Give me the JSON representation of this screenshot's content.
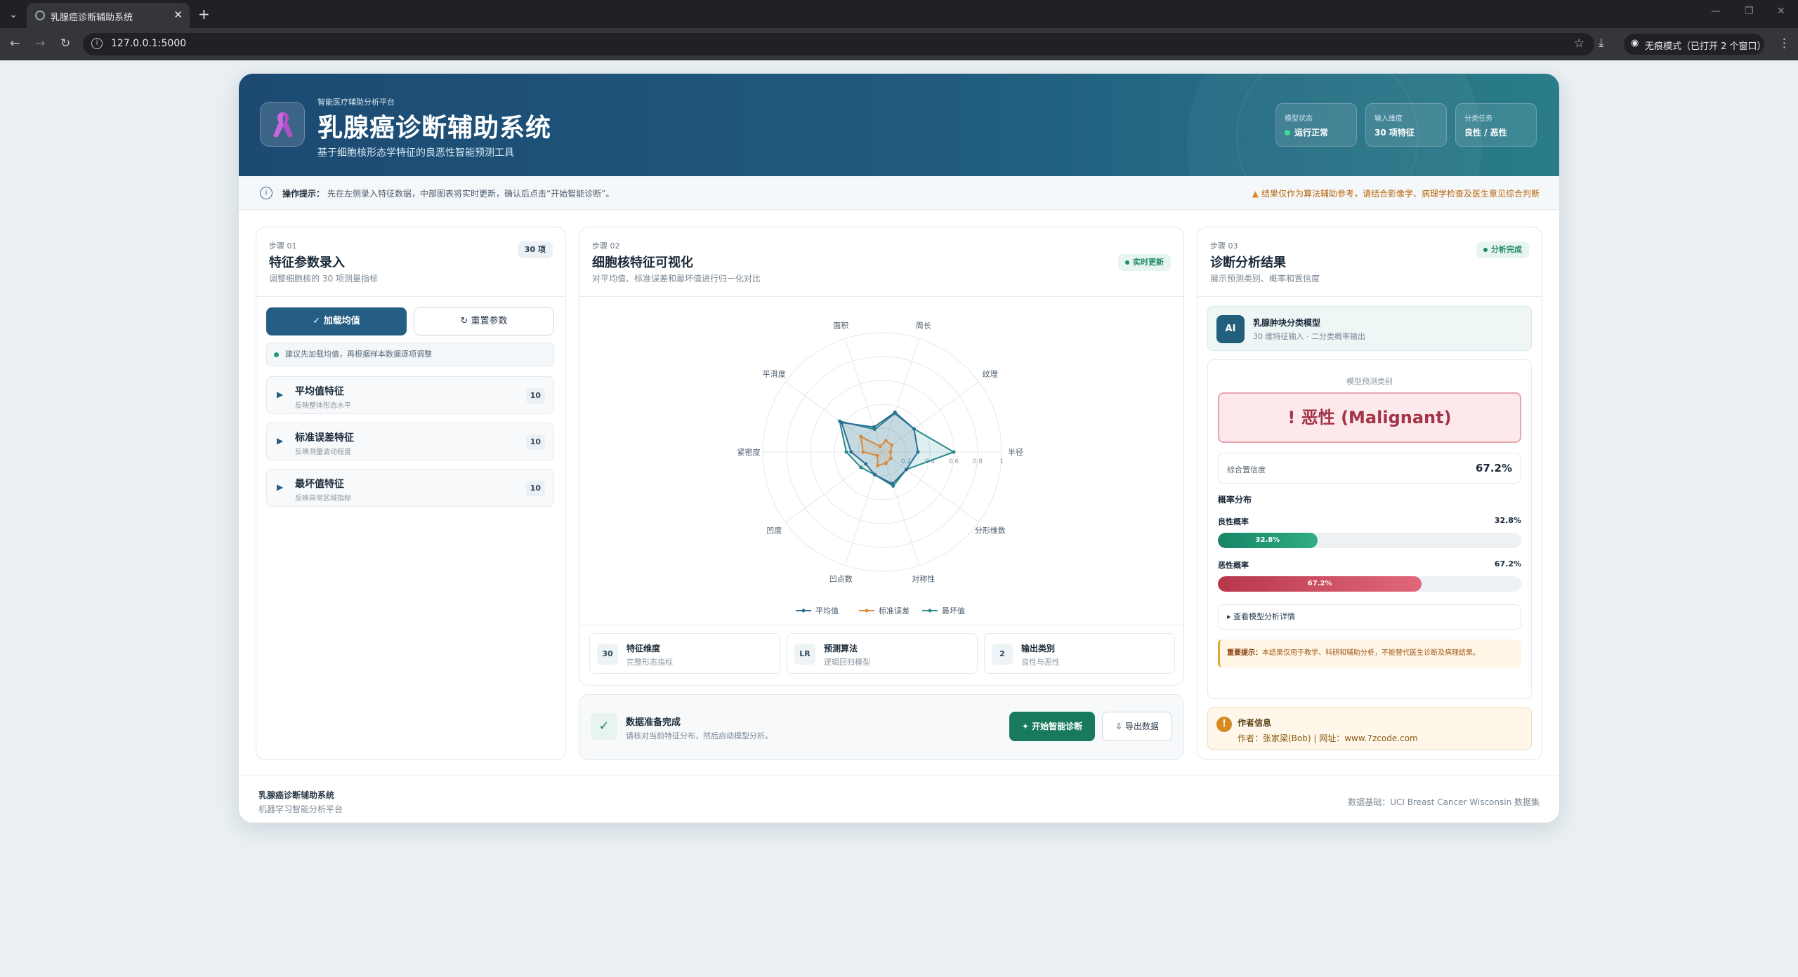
{
  "browser": {
    "tab_title": "乳腺癌诊断辅助系统",
    "url": "127.0.0.1:5000",
    "incognito_label": "无痕模式（已打开 2 个窗口）"
  },
  "header": {
    "kicker": "智能医疗辅助分析平台",
    "title": "乳腺癌诊断辅助系统",
    "subtitle": "基于细胞核形态学特征的良恶性智能预测工具",
    "logo_icon": "ribbon-icon",
    "stats": [
      {
        "label": "模型状态",
        "value": "运行正常"
      },
      {
        "label": "输入维度",
        "value": "30 项特征"
      },
      {
        "label": "分类任务",
        "value": "良性 / 恶性"
      }
    ]
  },
  "tipbar": {
    "label": "操作提示：",
    "text": "先在左侧录入特征数据，中部图表将实时更新，确认后点击“开始智能诊断”。",
    "warning": "结果仅作为算法辅助参考，请结合影像学、病理学检查及医生意见综合判断"
  },
  "input_panel": {
    "step": "步骤 01",
    "title": "特征参数录入",
    "subtitle": "调整细胞核的 30 项测量指标",
    "badge": "30 项",
    "load_button": "✓ 加载均值",
    "reset_button": "↻ 重置参数",
    "hint": "建议先加载均值，再根据样本数据逐项调整",
    "groups": [
      {
        "title": "平均值特征",
        "subtitle": "反映整体形态水平",
        "count": "10"
      },
      {
        "title": "标准误差特征",
        "subtitle": "反映测量波动程度",
        "count": "10"
      },
      {
        "title": "最坏值特征",
        "subtitle": "反映异常区域指标",
        "count": "10"
      }
    ]
  },
  "viz_panel": {
    "step": "步骤 02",
    "title": "细胞核特征可视化",
    "subtitle": "对平均值、标准误差和最坏值进行归一化对比",
    "badge": "实时更新",
    "stats": [
      {
        "num": "30",
        "title": "特征维度",
        "sub": "完整形态指标"
      },
      {
        "num": "LR",
        "title": "预测算法",
        "sub": "逻辑回归模型"
      },
      {
        "num": "2",
        "title": "输出类别",
        "sub": "良性与恶性"
      }
    ]
  },
  "chart_data": {
    "type": "radar",
    "axes": [
      "半径",
      "纹理",
      "周长",
      "面积",
      "平滑度",
      "紧密度",
      "凹度",
      "凹点数",
      "对称性",
      "分形维数"
    ],
    "rlim": [
      0,
      1
    ],
    "ticks": [
      "0.2",
      "0.4",
      "0.6",
      "0.8",
      "1"
    ],
    "legend_position": "bottom",
    "series": [
      {
        "name": "平均值",
        "color": "#2c6e96",
        "values": [
          0.3,
          0.33,
          0.35,
          0.22,
          0.42,
          0.26,
          0.17,
          0.2,
          0.28,
          0.25
        ]
      },
      {
        "name": "标准误差",
        "color": "#d98a3e",
        "values": [
          0.07,
          0.1,
          0.1,
          0.05,
          0.22,
          0.16,
          0.05,
          0.12,
          0.1,
          0.09
        ]
      },
      {
        "name": "最坏值",
        "color": "#2a8a8e",
        "values": [
          0.6,
          0.33,
          0.34,
          0.2,
          0.44,
          0.3,
          0.22,
          0.2,
          0.3,
          0.25
        ]
      }
    ]
  },
  "ready_bar": {
    "title": "数据准备完成",
    "subtitle": "请核对当前特征分布，然后启动模型分析。",
    "go_button": "✦ 开始智能诊断",
    "export_button": "⇩ 导出数据"
  },
  "result_panel": {
    "step": "步骤 03",
    "title": "诊断分析结果",
    "subtitle": "展示预测类别、概率和置信度",
    "badge": "分析完成",
    "model_title": "乳腺肿块分类模型",
    "model_sub": "30 维特征输入 · 二分类概率输出",
    "model_icon": "AI",
    "prediction_label": "模型预测类别",
    "prediction": "! 恶性 (Malignant)",
    "confidence_label": "综合置信度",
    "confidence": "67.2%",
    "dist_title": "概率分布",
    "benign_label": "良性概率",
    "benign_value": "32.8%",
    "benign_fraction": 0.328,
    "malignant_label": "恶性概率",
    "malignant_value": "67.2%",
    "malignant_fraction": 0.672,
    "details_toggle": "▸ 查看模型分析详情",
    "notice_label": "重要提示：",
    "notice_text": "本结果仅用于教学、科研和辅助分析，不能替代医生诊断及病理结果。",
    "author_title": "作者信息",
    "author_text": "作者：张家梁(Bob) | 网址：www.7zcode.com"
  },
  "footer": {
    "title": "乳腺癌诊断辅助系统",
    "subtitle": "机器学习智能分析平台",
    "source": "数据基础：UCI Breast Cancer Wisconsin 数据集"
  }
}
